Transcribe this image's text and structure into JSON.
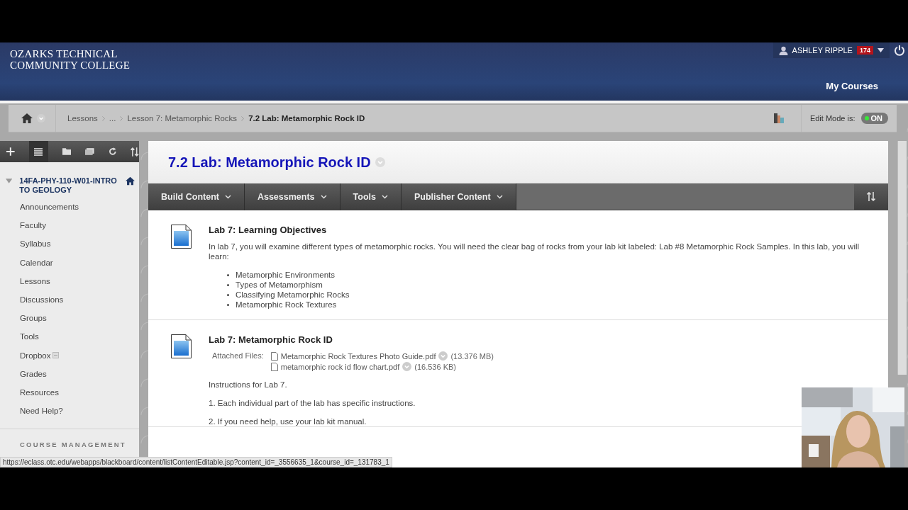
{
  "header": {
    "logo_lines": [
      "OZARKS TECHNICAL",
      "COMMUNITY COLLEGE"
    ],
    "user_name": "ASHLEY RIPPLE",
    "notification_count": "174",
    "tabs": [
      {
        "label": "My Courses",
        "selected": true
      }
    ]
  },
  "breadcrumbs": [
    {
      "label": "Lessons",
      "current": false
    },
    {
      "label": "...",
      "current": false
    },
    {
      "label": "Lesson 7: Metamorphic Rocks",
      "current": false
    },
    {
      "label": "7.2 Lab: Metamorphic Rock ID",
      "current": true
    }
  ],
  "edit_mode": {
    "label": "Edit Mode is:",
    "value": "ON",
    "on": true
  },
  "sidebar": {
    "course": {
      "title": "14FA-PHY-110-W01-INTRO TO GEOLOGY",
      "expanded": true
    },
    "items": [
      {
        "label": "Announcements",
        "kind": "link"
      },
      {
        "label": "Faculty",
        "kind": "link"
      },
      {
        "label": "Syllabus",
        "kind": "link"
      },
      {
        "label": "Calendar",
        "kind": "link"
      },
      {
        "label": "Lessons",
        "kind": "link"
      },
      {
        "label": "Discussions",
        "kind": "link"
      },
      {
        "label": "Groups",
        "kind": "link"
      },
      {
        "label": "Tools",
        "kind": "link"
      },
      {
        "label": "Dropbox",
        "kind": "hidden-link"
      },
      {
        "label": "Grades",
        "kind": "link"
      },
      {
        "label": "Resources",
        "kind": "link"
      },
      {
        "label": "Need Help?",
        "kind": "link"
      }
    ],
    "section": "COURSE MANAGEMENT"
  },
  "page_title": "7.2 Lab: Metamorphic Rock ID",
  "action_bar": [
    "Build Content",
    "Assessments",
    "Tools",
    "Publisher Content"
  ],
  "items": [
    {
      "title": "Lab 7: Learning Objectives",
      "text": "In lab 7, you will examine different types of metamorphic rocks. You will need the clear bag of rocks from your lab kit labeled: Lab #8 Metamorphic Rock Samples. In this lab, you will learn:",
      "bullets": [
        "Metamorphic Environments",
        "Types of Metamorphism",
        "Classifying Metamorphic Rocks",
        "Metamorphic Rock Textures"
      ]
    },
    {
      "title": "Lab 7: Metamorphic Rock ID",
      "files_label": "Attached Files:",
      "files": [
        {
          "name": "Metamorphic Rock Textures Photo Guide.pdf",
          "size": "(13.376 MB)"
        },
        {
          "name": "metamorphic rock id flow chart.pdf",
          "size": "(16.536 KB)"
        }
      ],
      "paragraphs": [
        "Instructions for Lab 7.",
        "1. Each individual part of the lab has specific instructions.",
        "2. If you need help, use your lab kit manual."
      ]
    }
  ],
  "status_url": "https://eclass.otc.edu/webapps/blackboard/content/listContentEditable.jsp?content_id=_3556635_1&course_id=_131783_1"
}
